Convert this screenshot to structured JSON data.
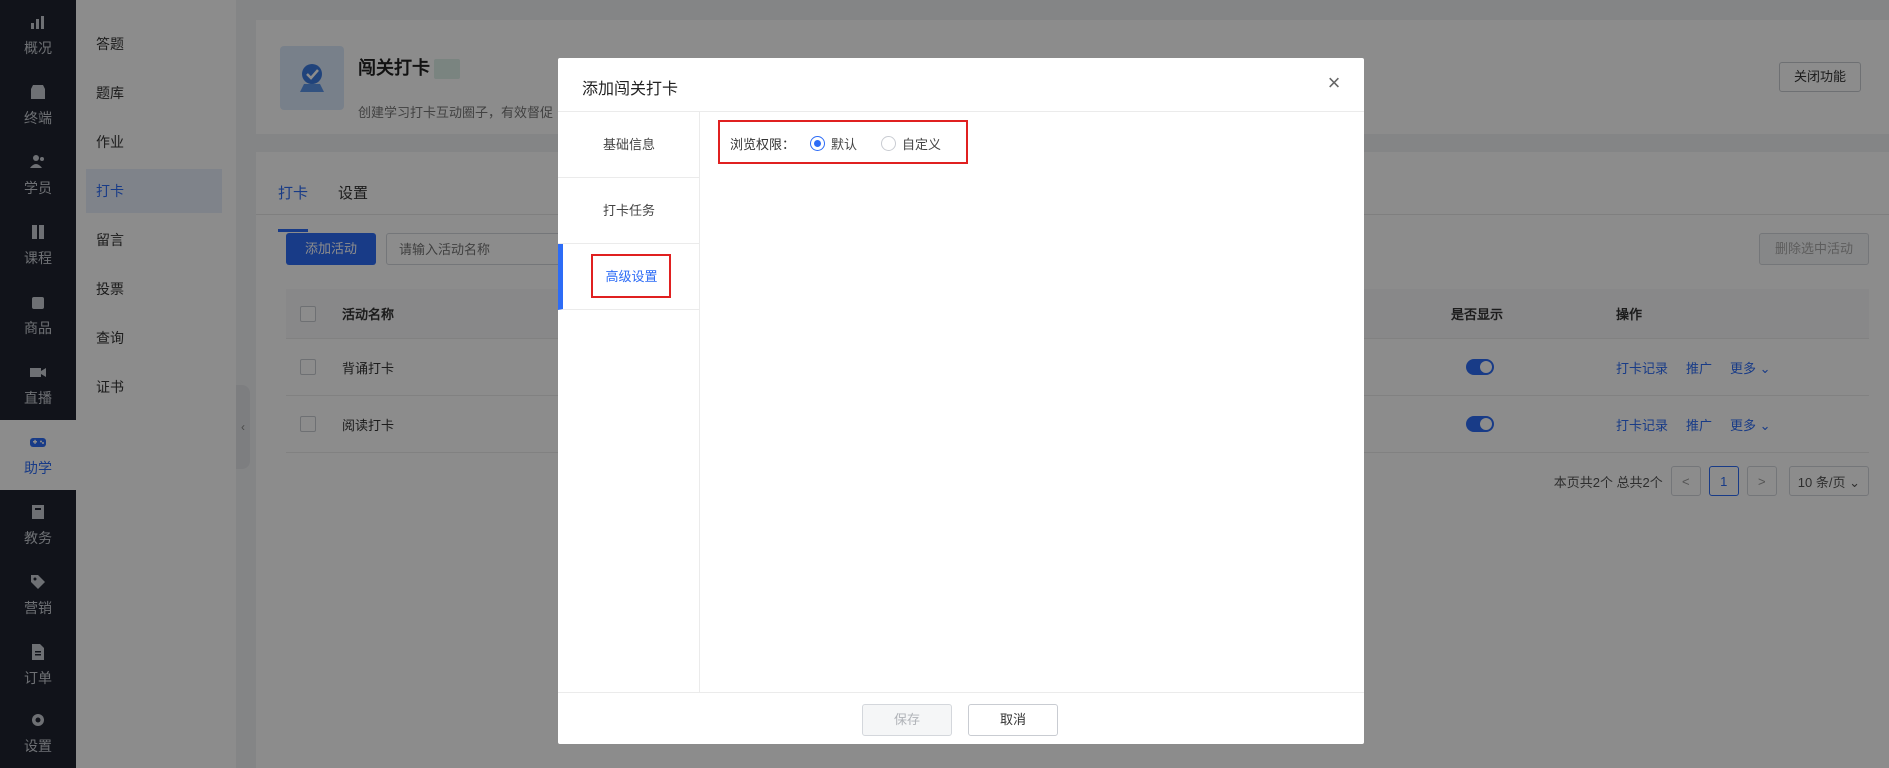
{
  "nav": [
    {
      "icon": "chart-icon",
      "label": "概况"
    },
    {
      "icon": "store-icon",
      "label": "终端"
    },
    {
      "icon": "users-icon",
      "label": "学员"
    },
    {
      "icon": "book-icon",
      "label": "课程"
    },
    {
      "icon": "bag-icon",
      "label": "商品"
    },
    {
      "icon": "video-icon",
      "label": "直播"
    },
    {
      "icon": "gamepad-icon",
      "label": "助学",
      "active": true
    },
    {
      "icon": "clipboard-icon",
      "label": "教务"
    },
    {
      "icon": "tag-icon",
      "label": "营销"
    },
    {
      "icon": "document-icon",
      "label": "订单"
    },
    {
      "icon": "gear-icon",
      "label": "设置"
    }
  ],
  "submenu": [
    "答题",
    "题库",
    "作业",
    "打卡",
    "留言",
    "投票",
    "查询",
    "证书"
  ],
  "submenu_active": "打卡",
  "header": {
    "title": "闯关打卡",
    "desc": "创建学习打卡互动圈子，有效督促",
    "close_button": "关闭功能"
  },
  "tabs": [
    "打卡",
    "设置"
  ],
  "toolbar": {
    "add_button": "添加活动",
    "search_placeholder": "请输入活动名称",
    "delete_button": "删除选中活动"
  },
  "table": {
    "columns": [
      "活动名称",
      "是否显示",
      "操作"
    ],
    "rows": [
      {
        "name": "背诵打卡",
        "visible": true,
        "actions": [
          "打卡记录",
          "推广",
          "更多 ⌄"
        ]
      },
      {
        "name": "阅读打卡",
        "visible": true,
        "actions": [
          "打卡记录",
          "推广",
          "更多 ⌄"
        ]
      }
    ]
  },
  "pager": {
    "summary": "本页共2个 总共2个",
    "prev": "<",
    "current": "1",
    "next": ">",
    "page_size": "10 条/页 ⌄"
  },
  "modal": {
    "title": "添加闯关打卡",
    "close": "×",
    "side_items": [
      "基础信息",
      "打卡任务",
      "高级设置"
    ],
    "active_side": "高级设置",
    "field_label": "浏览权限：",
    "radio_options": [
      "默认",
      "自定义"
    ],
    "radio_selected": "默认",
    "save_button": "保存",
    "cancel_button": "取消"
  },
  "colors": {
    "accent": "#2d6cf6",
    "nav_bg": "#1f2430",
    "highlight": "#e02020"
  }
}
